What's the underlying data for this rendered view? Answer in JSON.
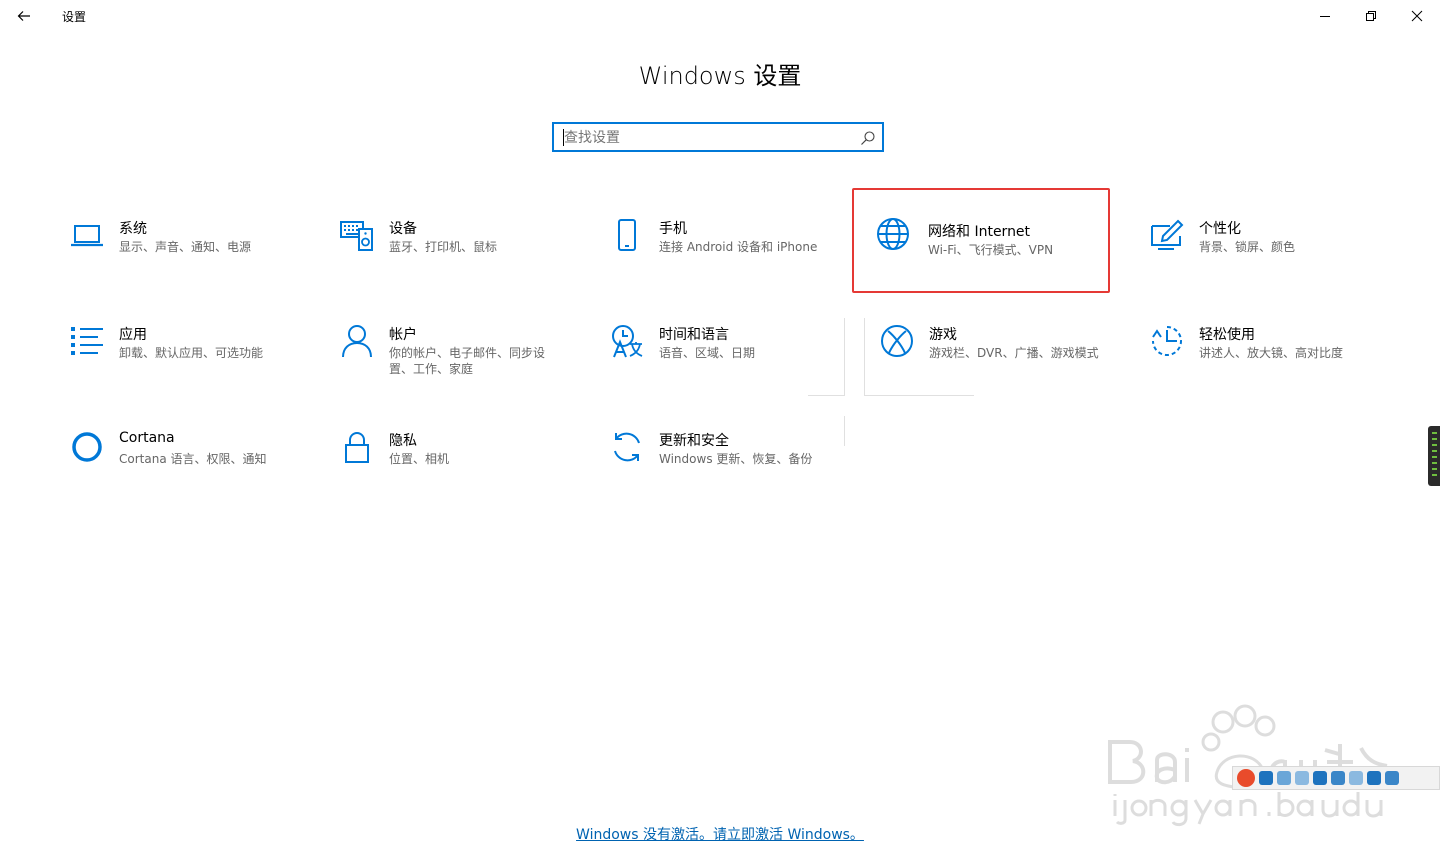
{
  "window": {
    "title": "设置",
    "controls": {
      "minimize": "minimize",
      "maximize": "maximize",
      "close": "close"
    }
  },
  "page": {
    "title": "Windows 设置"
  },
  "search": {
    "placeholder": "查找设置",
    "value": ""
  },
  "tiles": [
    {
      "name": "系统",
      "desc": "显示、声音、通知、电源",
      "icon": "laptop-icon"
    },
    {
      "name": "设备",
      "desc": "蓝牙、打印机、鼠标",
      "icon": "devices-icon"
    },
    {
      "name": "手机",
      "desc": "连接 Android 设备和 iPhone",
      "icon": "phone-icon"
    },
    {
      "name": "网络和 Internet",
      "desc": "Wi-Fi、飞行模式、VPN",
      "icon": "globe-icon"
    },
    {
      "name": "个性化",
      "desc": "背景、锁屏、颜色",
      "icon": "personalization-icon"
    },
    {
      "name": "应用",
      "desc": "卸载、默认应用、可选功能",
      "icon": "apps-list-icon"
    },
    {
      "name": "帐户",
      "desc": "你的帐户、电子邮件、同步设置、工作、家庭",
      "icon": "person-icon"
    },
    {
      "name": "时间和语言",
      "desc": "语音、区域、日期",
      "icon": "time-language-icon"
    },
    {
      "name": "游戏",
      "desc": "游戏栏、DVR、广播、游戏模式",
      "icon": "xbox-icon"
    },
    {
      "name": "轻松使用",
      "desc": "讲述人、放大镜、高对比度",
      "icon": "ease-of-access-icon"
    },
    {
      "name": "Cortana",
      "desc": "Cortana 语言、权限、通知",
      "icon": "cortana-icon"
    },
    {
      "name": "隐私",
      "desc": "位置、相机",
      "icon": "lock-icon"
    },
    {
      "name": "更新和安全",
      "desc": "Windows 更新、恢复、备份",
      "icon": "update-icon"
    }
  ],
  "highlighted_tile": "网络和 Internet",
  "activation": {
    "text": "Windows 没有激活。请立即激活 Windows。"
  },
  "colors": {
    "accent": "#0078d7",
    "highlight_border": "#e53935",
    "link": "#0063b1"
  }
}
